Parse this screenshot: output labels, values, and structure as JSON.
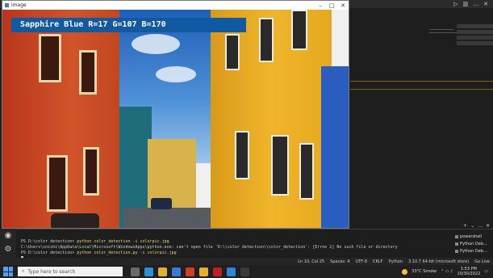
{
  "window": {
    "title": "image"
  },
  "overlay": {
    "color_text": "Sapphire Blue R=17 G=107 B=170",
    "label_bg": "#105aa4"
  },
  "terminal": {
    "lines": [
      {
        "prompt": "PS D:\\color detection>",
        "command": "python color_detection -i colorpic.jpg"
      },
      {
        "text": "C:\\Users\\cnishi\\AppData\\Local\\Microsoft\\WindowsApps\\python.exe: can't open file 'D:\\\\color detection\\\\color_detection': [Errno 2] No such file or directory"
      },
      {
        "prompt": "PS D:\\color detection>",
        "command": "python color_detection.py -i colorpic.jpg"
      }
    ],
    "tabs": [
      "powershell",
      "Python Deb...",
      "Python Deb..."
    ]
  },
  "statusbar": {
    "position": "Ln 10, Col 25",
    "spaces": "Spaces: 4",
    "encoding": "UTF-8",
    "eol": "CRLF",
    "language": "Python",
    "interpreter": "3.10.7 64-bit (microsoft store)",
    "golive": "Go Live"
  },
  "taskbar": {
    "search_placeholder": "Type here to search",
    "weather": "33°C Smoke",
    "time": "1:53 PM",
    "date": "10/30/2022"
  },
  "icons": [
    "search-icon",
    "account-icon",
    "gear-icon",
    "windows-start-icon"
  ]
}
